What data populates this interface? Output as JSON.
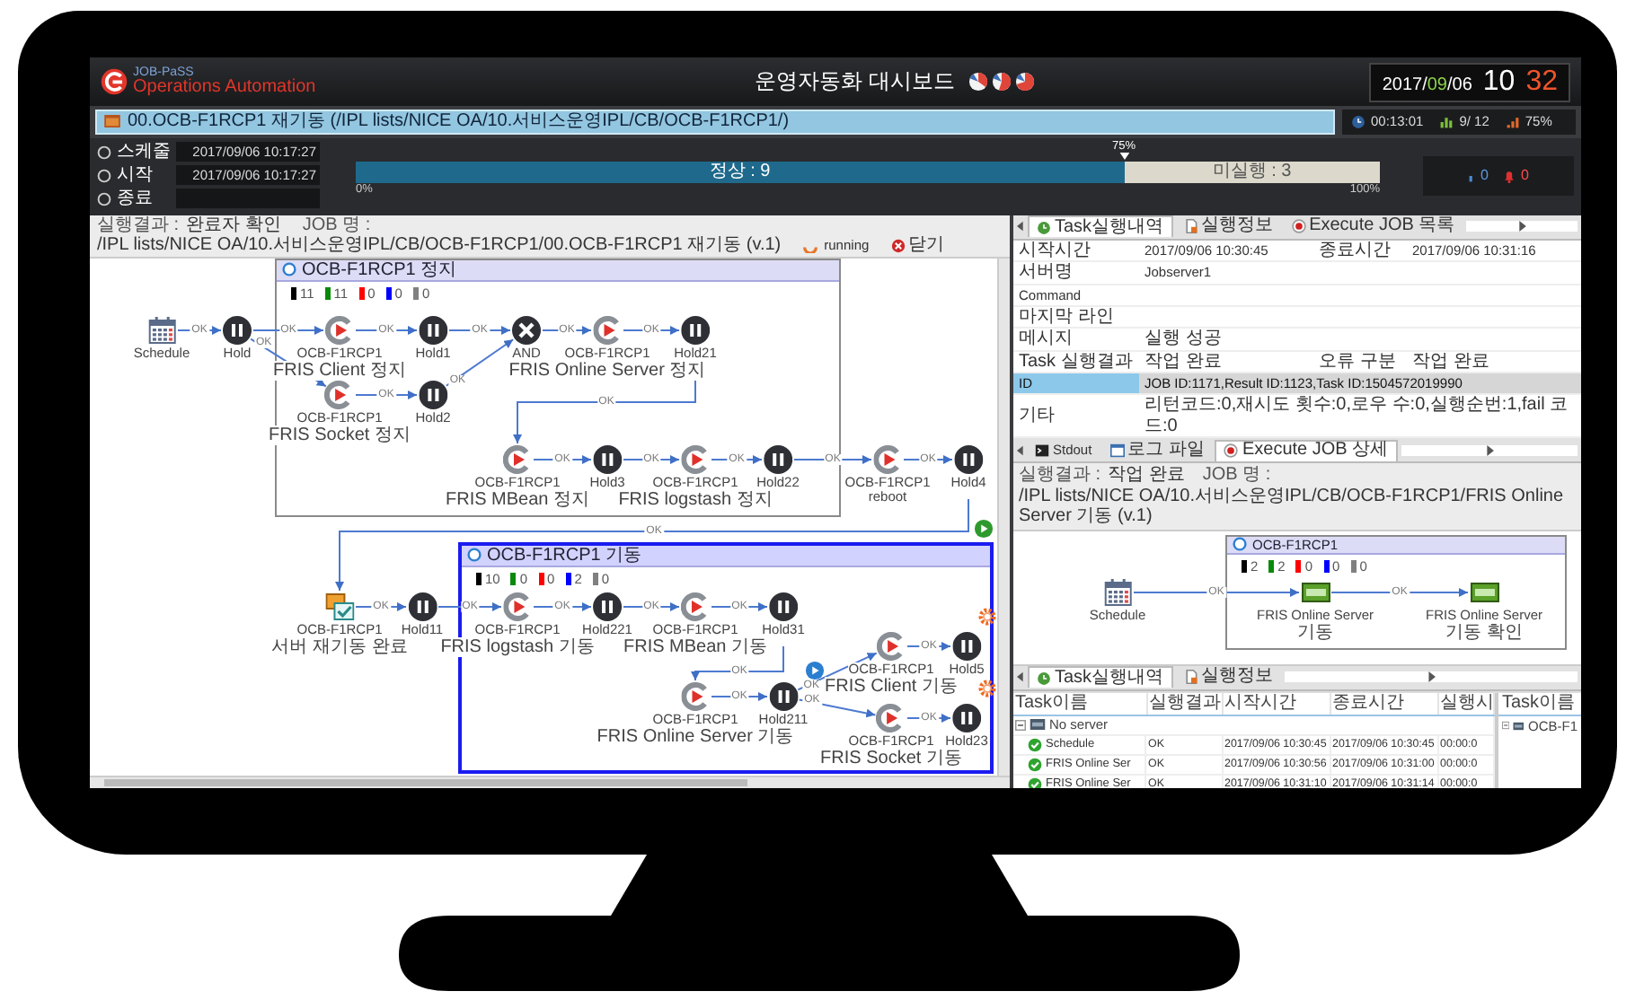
{
  "header": {
    "logo_top": "JOB-PaSS",
    "logo_bottom": "Operations Automation",
    "title": "운영자동화 대시보드",
    "date": [
      {
        "text": "2017/",
        "highlight": false
      },
      {
        "text": "09",
        "highlight": true
      },
      {
        "text": "/06",
        "highlight": false
      }
    ],
    "hour": "10",
    "minute": "32"
  },
  "job_bar": {
    "title": "00.OCB-F1RCP1 재기동 (/IPL lists/NICE OA/10.서비스운영IPL/CB/OCB-F1RCP1/)",
    "elapsed": "00:13:01",
    "count": "9/ 12",
    "percent": "75%"
  },
  "schedule_rows": [
    {
      "label": "스케줄",
      "value": "2017/09/06 10:17:27"
    },
    {
      "label": "시작",
      "value": "2017/09/06 10:17:27"
    },
    {
      "label": "종료"
    }
  ],
  "progress": {
    "marker": "75%",
    "level": 0.75,
    "done_label": "정상 : 9",
    "rest_label": "미실행 : 3",
    "start": "0%",
    "end": "100%"
  },
  "alerts": {
    "warnings": "0",
    "errors": "0"
  },
  "flow_panel": {
    "toolbar": [
      {
        "label": "실행결과 :",
        "value": "완료자 확인"
      },
      {
        "label": "JOB 명 :",
        "value": "/IPL lists/NICE OA/10.서비스운영IPL/CB/OCB-F1RCP1/00.OCB-F1RCP1 재기동 (v.1)"
      }
    ],
    "status": "running",
    "close": "닫기",
    "groups": [
      {
        "title": "OCB-F1RCP1 정지",
        "selected": false,
        "counts": [
          {
            "color": "#000000",
            "value": "11"
          },
          {
            "color": "#0a8a0a",
            "value": "11"
          },
          {
            "color": "#ff0000",
            "value": "0"
          },
          {
            "color": "#0000ff",
            "value": "0"
          },
          {
            "color": "#808080",
            "value": "0"
          }
        ]
      },
      {
        "title": "OCB-F1RCP1 기동",
        "selected": true,
        "start_button": true,
        "counts": [
          {
            "color": "#000000",
            "value": "10"
          },
          {
            "color": "#0a8a0a",
            "value": "0"
          },
          {
            "color": "#ff0000",
            "value": "0"
          },
          {
            "color": "#0000ff",
            "value": "2"
          },
          {
            "color": "#808080",
            "value": "0"
          }
        ]
      }
    ],
    "nodes": [
      {
        "kind": "schedule",
        "lines": [
          "Schedule"
        ]
      },
      {
        "kind": "hold",
        "lines": [
          "Hold"
        ]
      },
      {
        "kind": "job",
        "lines": [
          "OCB-F1RCP1",
          "FRIS Client 정지"
        ]
      },
      {
        "kind": "hold",
        "lines": [
          "Hold1"
        ]
      },
      {
        "kind": "and",
        "lines": [
          "AND"
        ]
      },
      {
        "kind": "job",
        "lines": [
          "OCB-F1RCP1",
          "FRIS Online Server 정지"
        ]
      },
      {
        "kind": "hold",
        "lines": [
          "Hold21"
        ]
      },
      {
        "kind": "job",
        "lines": [
          "OCB-F1RCP1",
          "FRIS Socket 정지"
        ]
      },
      {
        "kind": "hold",
        "lines": [
          "Hold2"
        ]
      },
      {
        "kind": "job",
        "lines": [
          "OCB-F1RCP1",
          "FRIS MBean 정지"
        ]
      },
      {
        "kind": "hold",
        "lines": [
          "Hold3"
        ]
      },
      {
        "kind": "job",
        "lines": [
          "OCB-F1RCP1",
          "FRIS logstash 정지"
        ]
      },
      {
        "kind": "hold",
        "lines": [
          "Hold22"
        ]
      },
      {
        "kind": "job",
        "lines": [
          "OCB-F1RCP1",
          "reboot"
        ]
      },
      {
        "kind": "hold",
        "lines": [
          "Hold4"
        ]
      },
      {
        "kind": "notify",
        "lines": [
          "OCB-F1RCP1",
          "서버 재기동 완료"
        ]
      },
      {
        "kind": "hold",
        "lines": [
          "Hold11"
        ]
      },
      {
        "kind": "job",
        "lines": [
          "OCB-F1RCP1",
          "FRIS logstash 기동"
        ]
      },
      {
        "kind": "hold",
        "lines": [
          "Hold221"
        ]
      },
      {
        "kind": "job",
        "lines": [
          "OCB-F1RCP1",
          "FRIS MBean 기동"
        ]
      },
      {
        "kind": "hold",
        "lines": [
          "Hold31"
        ]
      },
      {
        "kind": "job",
        "lines": [
          "OCB-F1RCP1",
          "FRIS Online Server 기동"
        ]
      },
      {
        "kind": "hold",
        "lines": [
          "Hold211"
        ],
        "play_button": true
      },
      {
        "kind": "job",
        "lines": [
          "OCB-F1RCP1",
          "FRIS Client 기동"
        ]
      },
      {
        "kind": "hold",
        "lines": [
          "Hold5"
        ],
        "spinner": true
      },
      {
        "kind": "job",
        "lines": [
          "OCB-F1RCP1",
          "FRIS Socket 기동"
        ]
      },
      {
        "kind": "hold",
        "lines": [
          "Hold23"
        ],
        "spinner": true
      }
    ],
    "edges": [
      {
        "label": "OK"
      },
      {
        "label": "OK"
      },
      {
        "label": "OK"
      },
      {
        "label": "OK"
      },
      {
        "label": "OK"
      },
      {
        "label": "OK"
      },
      {
        "label": "OK"
      },
      {
        "label": "OK"
      },
      {
        "label": "OK"
      },
      {
        "label": "OK"
      },
      {
        "label": "OK"
      },
      {
        "label": "OK"
      },
      {
        "label": "OK"
      },
      {
        "label": "OK"
      },
      {
        "label": "OK"
      },
      {
        "label": "OK"
      },
      {
        "label": "OK"
      },
      {
        "label": "OK"
      },
      {
        "label": "OK"
      },
      {
        "label": "OK"
      },
      {
        "label": "OK"
      },
      {
        "label": "OK"
      },
      {
        "label": "OK"
      },
      {
        "label": "OK"
      },
      {
        "label": "OK"
      },
      {
        "label": "OK"
      },
      {
        "label": "OK"
      }
    ]
  },
  "detail_panel": {
    "tabs": [
      {
        "label": "Task실행내역",
        "selected": true
      },
      {
        "label": "실행정보",
        "selected": false
      },
      {
        "label": "Execute JOB 목록",
        "selected": false
      }
    ],
    "rows": [
      {
        "label": "시작시간",
        "value": "2017/09/06 10:30:45",
        "label_2": "종료시간",
        "value_2": "2017/09/06 10:31:16",
        "selected": false
      },
      {
        "label": "서버명",
        "value": "Jobserver1",
        "selected": false
      },
      {
        "label": "Command",
        "selected": false
      },
      {
        "label": "마지막 라인",
        "selected": false
      },
      {
        "label": "메시지",
        "value": "실행 성공",
        "selected": false
      },
      {
        "label": "Task 실행결과",
        "value": "작업 완료",
        "label_2": "오류 구분",
        "value_2": "작업 완료",
        "selected": false
      },
      {
        "label": "ID",
        "value": "JOB ID:1171,Result ID:1123,Task ID:1504572019990",
        "selected": true
      },
      {
        "label": "기타",
        "value": "리턴코드:0,재시도 횟수:0,로우 수:0,실행순번:1,fail 코드:0",
        "selected": false
      }
    ]
  },
  "job_detail_panel": {
    "tabs": [
      {
        "label": "Stdout",
        "selected": false
      },
      {
        "label": "로그 파일",
        "selected": false
      },
      {
        "label": "Execute JOB 상세",
        "selected": true
      }
    ],
    "toolbar": [
      {
        "label": "실행결과 :",
        "value": "작업 완료"
      },
      {
        "label": "JOB 명 :",
        "value": "/IPL lists/NICE OA/10.서비스운영IPL/CB/OCB-F1RCP1/FRIS Online Server 기동 (v.1)"
      }
    ],
    "group": {
      "title": "OCB-F1RCP1",
      "counts": [
        {
          "color": "#000000",
          "value": "2"
        },
        {
          "color": "#0a8a0a",
          "value": "2"
        },
        {
          "color": "#ff0000",
          "value": "0"
        },
        {
          "color": "#0000ff",
          "value": "0"
        },
        {
          "color": "#808080",
          "value": "0"
        }
      ]
    },
    "nodes": [
      {
        "kind": "schedule",
        "lines": [
          "Schedule"
        ]
      },
      {
        "kind": "server",
        "lines": [
          "FRIS Online Server",
          "기동"
        ]
      },
      {
        "kind": "server",
        "lines": [
          "FRIS Online Server",
          "기동 확인"
        ]
      }
    ],
    "edges": [
      {
        "label": "OK"
      },
      {
        "label": "OK"
      }
    ]
  },
  "task_panel": {
    "tabs": [
      {
        "label": "Task실행내역",
        "selected": true
      },
      {
        "label": "실행정보",
        "selected": false
      }
    ],
    "columns": [
      "Task이름",
      "실행결과",
      "시작시간",
      "종료시간",
      "실행시"
    ],
    "rows": [
      {
        "name": "No server",
        "expanded": true,
        "children": [
          {
            "name": "Schedule",
            "result": "OK",
            "start": "2017/09/06 10:30:45",
            "end": "2017/09/06 10:30:45",
            "duration": "00:00:0"
          },
          {
            "name": "FRIS Online Ser",
            "result": "OK",
            "start": "2017/09/06 10:30:56",
            "end": "2017/09/06 10:31:00",
            "duration": "00:00:0"
          },
          {
            "name": "FRIS Online Ser",
            "result": "OK",
            "start": "2017/09/06 10:31:10",
            "end": "2017/09/06 10:31:14",
            "duration": "00:00:0"
          }
        ]
      }
    ],
    "side_column": "Task이름",
    "side_rows": [
      {
        "name": "OCB-F1",
        "expanded": true
      }
    ]
  }
}
